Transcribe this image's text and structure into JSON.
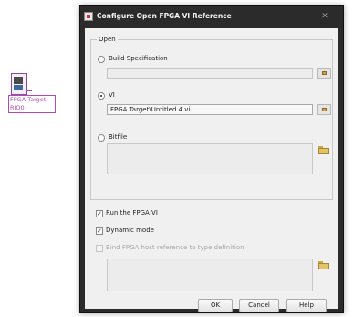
{
  "node": {
    "label_line1": "FPGA Target",
    "label_line2": "RIO0"
  },
  "dialog": {
    "title": "Configure Open FPGA VI Reference",
    "close_glyph": "✕",
    "open_group": {
      "legend": "Open",
      "build_spec": {
        "label": "Build Specification",
        "selected": false,
        "value": ""
      },
      "vi": {
        "label": "VI",
        "selected": true,
        "value": "FPGA Target\\Untitled 4.vi"
      },
      "bitfile": {
        "label": "Bitfile",
        "selected": false,
        "value": ""
      }
    },
    "options": {
      "run_fpga_vi": {
        "label": "Run the FPGA VI",
        "checked": true
      },
      "dynamic_mode": {
        "label": "Dynamic mode",
        "checked": true
      },
      "bind_host_ref": {
        "label": "Bind FPGA host reference to type definition",
        "checked": false,
        "enabled": false
      }
    },
    "check_glyph": "✓",
    "buttons": {
      "ok": "OK",
      "cancel": "Cancel",
      "help": "Help"
    }
  }
}
